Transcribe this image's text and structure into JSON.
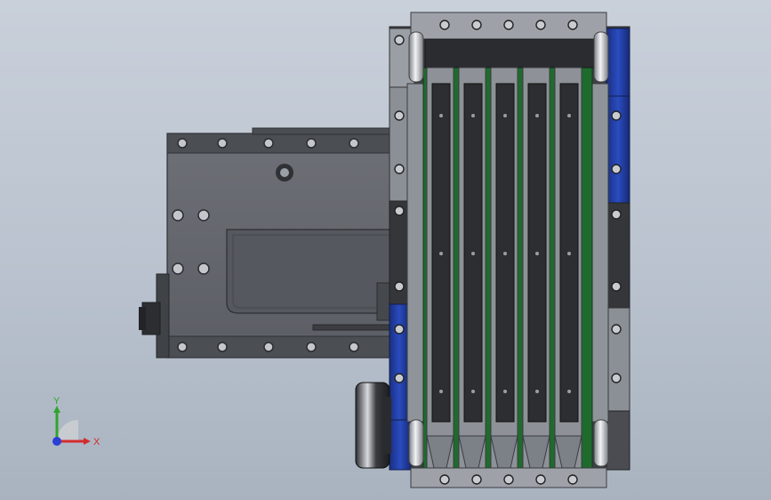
{
  "viewport": {
    "background_top": "#c9d0da",
    "background_bottom": "#a9b3c0"
  },
  "model": {
    "description_hidden": "",
    "colors": {
      "steel_dark": "#3e4044",
      "steel_mid": "#5d6066",
      "steel_light": "#8a8e95",
      "plate": "#66696f",
      "blue_housing": "#1f3c9a",
      "green_pcb": "#1f6b2e",
      "roller_silver": "#c9ccd1"
    }
  },
  "triad": {
    "x_label": "X",
    "y_label": "Y",
    "x_color": "#d42b2b",
    "y_color": "#2fa52f",
    "z_color": "#2a3fd4"
  }
}
